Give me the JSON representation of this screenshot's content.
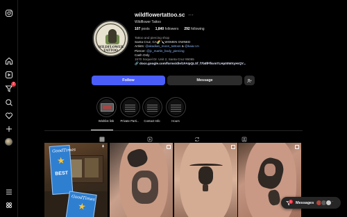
{
  "profile": {
    "username": "wildflowertattoo.sc",
    "more": "···",
    "full_name": "Wildflower Tattoo",
    "avatar_text_1": "WILDFLOWER",
    "avatar_text_2": "TATTOO",
    "stats": {
      "posts_count": "107",
      "posts_label": "posts",
      "followers_count": "1,840",
      "followers_label": "followers",
      "following_count": "292",
      "following_label": "following"
    },
    "bio": {
      "category": "Tattoo and piercing shop",
      "line1": "Santa Cruz, CA🌈🔪WOMEN OWNED",
      "artists_prefix": "Artists: ",
      "artist_1": "@akadian_moon_tattoos",
      "artists_sep": " & ",
      "artist_2": "@kaia.t.m",
      "piercer_prefix": "Piercer: ",
      "piercer": "@jc_martin_body_piercing",
      "line4": "Cash Only",
      "address": "1570 Soquel Dr. Unit 2, Santa Cruz 95065",
      "url": "docs.google.com/forms/d/e/1FAIpQLSf_f7b8fFfkvmTLHp00WXyHrQY..."
    },
    "buttons": {
      "follow": "Follow",
      "message": "Message"
    }
  },
  "highlights": [
    {
      "label": "Wishlist link"
    },
    {
      "label": "Private Parti..."
    },
    {
      "label": "Contact Info"
    },
    {
      "label": "Hours"
    }
  ],
  "tabs": [
    {
      "icon": "grid-icon",
      "active": true
    },
    {
      "icon": "reels-icon",
      "active": false
    },
    {
      "icon": "reposts-icon",
      "active": false
    },
    {
      "icon": "tagged-icon",
      "active": false
    }
  ],
  "posts": [
    {
      "magazine_title": "GoodTimes",
      "magazine_best": "BEST"
    },
    {
      "subject": "butterfly tattoo"
    },
    {
      "subject": "skull tattoo"
    },
    {
      "subject": "hand and flower tattoo"
    }
  ],
  "messages": {
    "label": "Messages",
    "badge": "1"
  },
  "notifications_badge": "2",
  "colors": {
    "accent": "#4a5df9",
    "badge": "#ff3040",
    "link": "#8ab4f8",
    "background": "#000000"
  }
}
